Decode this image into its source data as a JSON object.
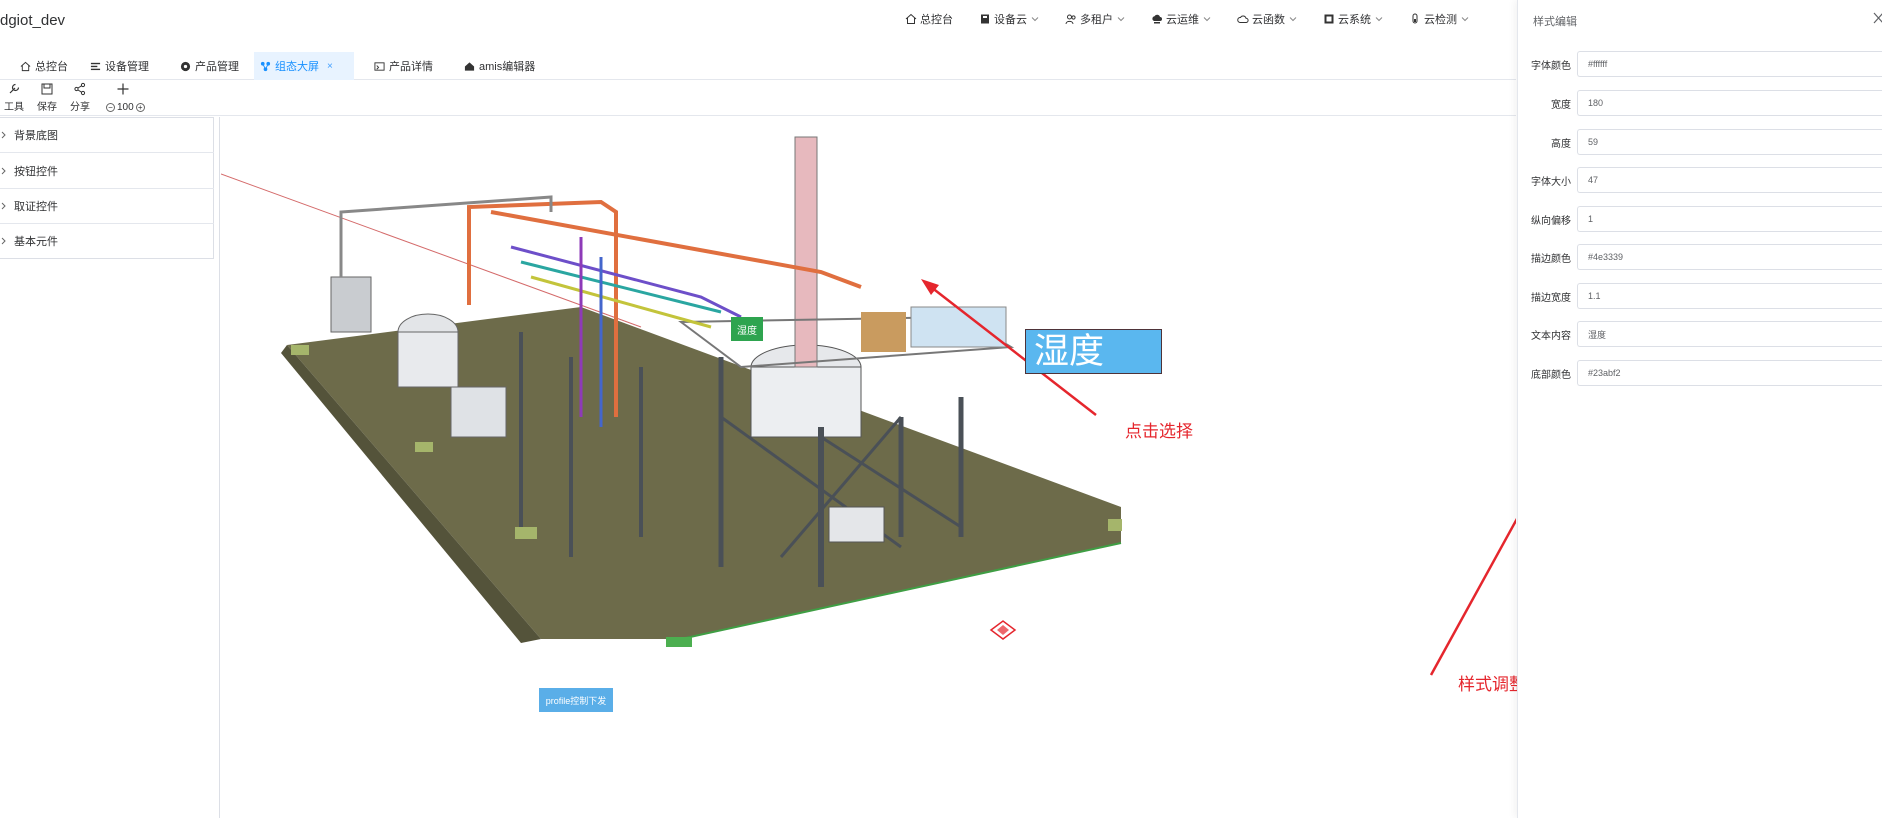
{
  "brand": "dgiot_dev",
  "topnav": [
    {
      "label": "总控台",
      "icon": "home-icon",
      "has_menu": false
    },
    {
      "label": "设备云",
      "icon": "device-icon",
      "has_menu": true
    },
    {
      "label": "多租户",
      "icon": "users-icon",
      "has_menu": true
    },
    {
      "label": "云运维",
      "icon": "cloud-ops-icon",
      "has_menu": true
    },
    {
      "label": "云函数",
      "icon": "cloud-function-icon",
      "has_menu": true
    },
    {
      "label": "云系统",
      "icon": "cloud-system-icon",
      "has_menu": true
    },
    {
      "label": "云检测",
      "icon": "cloud-test-icon",
      "has_menu": true
    }
  ],
  "tabs": [
    {
      "label": "总控台",
      "icon": "home-icon",
      "active": false
    },
    {
      "label": "设备管理",
      "icon": "list-icon",
      "active": false
    },
    {
      "label": "产品管理",
      "icon": "product-icon",
      "active": false
    },
    {
      "label": "组态大屏",
      "icon": "topology-icon",
      "active": true,
      "close": "×"
    },
    {
      "label": "产品详情",
      "icon": "detail-icon",
      "active": false
    },
    {
      "label": "amis编辑器",
      "icon": "editor-icon",
      "active": false
    }
  ],
  "toolbar": {
    "tools_label": "工具",
    "save_label": "保存",
    "share_label": "分享",
    "zoom_value": "100",
    "zoom_out": "−",
    "zoom_in": "+"
  },
  "sidebar": {
    "items": [
      "背景底图",
      "按钮控件",
      "取证控件",
      "基本元件"
    ]
  },
  "canvas": {
    "green_label": "湿度",
    "big_label": "湿度",
    "button_label": "profile控制下发",
    "annotation_click": "点击选择",
    "annotation_style": "样式调整"
  },
  "panel": {
    "title": "样式编辑",
    "fields": [
      {
        "label": "字体颜色",
        "value": "#ffffff"
      },
      {
        "label": "宽度",
        "value": "180"
      },
      {
        "label": "高度",
        "value": "59"
      },
      {
        "label": "字体大小",
        "value": "47"
      },
      {
        "label": "纵向偏移",
        "value": "1"
      },
      {
        "label": "描边颜色",
        "value": "#4e3339"
      },
      {
        "label": "描边宽度",
        "value": "1.1"
      },
      {
        "label": "文本内容",
        "value": "湿度"
      },
      {
        "label": "底部颜色",
        "value": "#23abf2"
      }
    ]
  },
  "colors": {
    "accent": "#1890ff",
    "active_tab_bg": "#e8f3ff",
    "annotation_red": "#e5262d",
    "label_green": "#2ea44f",
    "label_blue": "#5ab7ef"
  }
}
